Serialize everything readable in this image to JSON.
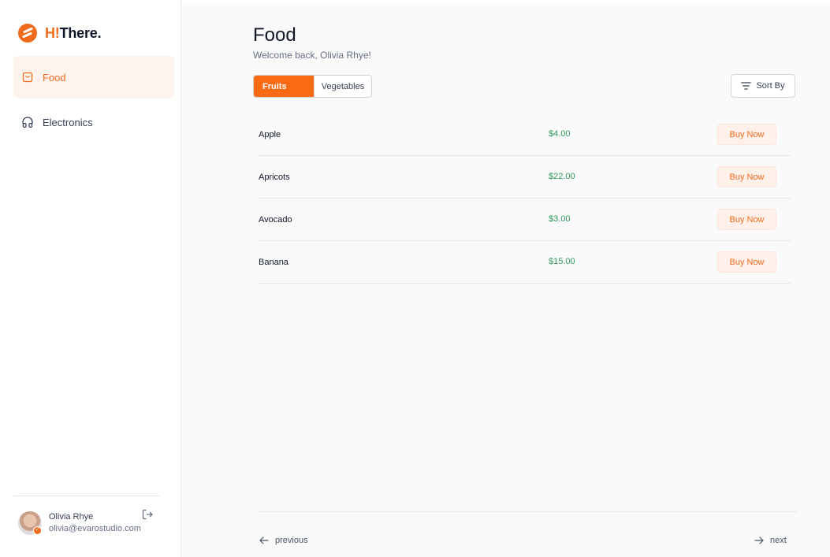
{
  "brand": {
    "name_accent": "H!",
    "name_rest": "There.",
    "accent_color": "#f26b1d"
  },
  "sidebar": {
    "items": [
      {
        "label": "Food",
        "icon": "shopping-bag-icon",
        "active": true
      },
      {
        "label": "Electronics",
        "icon": "headphones-icon",
        "active": false
      }
    ]
  },
  "user": {
    "name": "Olivia Rhye",
    "email": "olivia@evarostudio.com"
  },
  "header": {
    "title": "Food",
    "subtitle": "Welcome back, Olivia Rhye!"
  },
  "tabs": [
    {
      "label": "Fruits",
      "selected": true
    },
    {
      "label": "Vegetables",
      "selected": false
    }
  ],
  "sort": {
    "label": "Sort By"
  },
  "products": [
    {
      "name": "Apple",
      "price": "$4.00",
      "action": "Buy Now"
    },
    {
      "name": "Apricots",
      "price": "$22.00",
      "action": "Buy Now"
    },
    {
      "name": "Avocado",
      "price": "$3.00",
      "action": "Buy Now"
    },
    {
      "name": "Banana",
      "price": "$15.00",
      "action": "Buy Now"
    }
  ],
  "pagination": {
    "previous": "previous",
    "next": "next"
  }
}
